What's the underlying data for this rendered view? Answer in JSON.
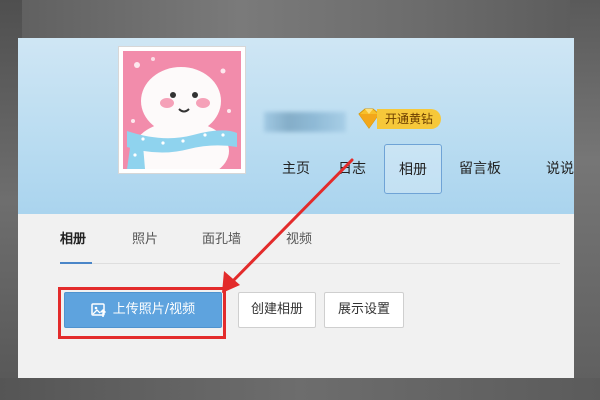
{
  "profile": {
    "vip_label": "开通黄钻"
  },
  "nav": {
    "items": [
      {
        "label": "主页"
      },
      {
        "label": "日志"
      },
      {
        "label": "相册"
      },
      {
        "label": "留言板"
      },
      {
        "label": "说说"
      }
    ],
    "active": "相册"
  },
  "album_tabs": {
    "items": [
      {
        "label": "相册"
      },
      {
        "label": "照片"
      },
      {
        "label": "面孔墙"
      },
      {
        "label": "视频"
      }
    ],
    "active": "相册"
  },
  "actions": {
    "upload_label": "上传照片/视频",
    "create_album_label": "创建相册",
    "display_settings_label": "展示设置"
  },
  "annotation": {
    "highlight_color": "#e32b2b",
    "target": "upload-button"
  },
  "colors": {
    "header_blue": "#b9dcf1",
    "upload_button": "#5ea3de",
    "vip_gold": "#f6c83a"
  }
}
